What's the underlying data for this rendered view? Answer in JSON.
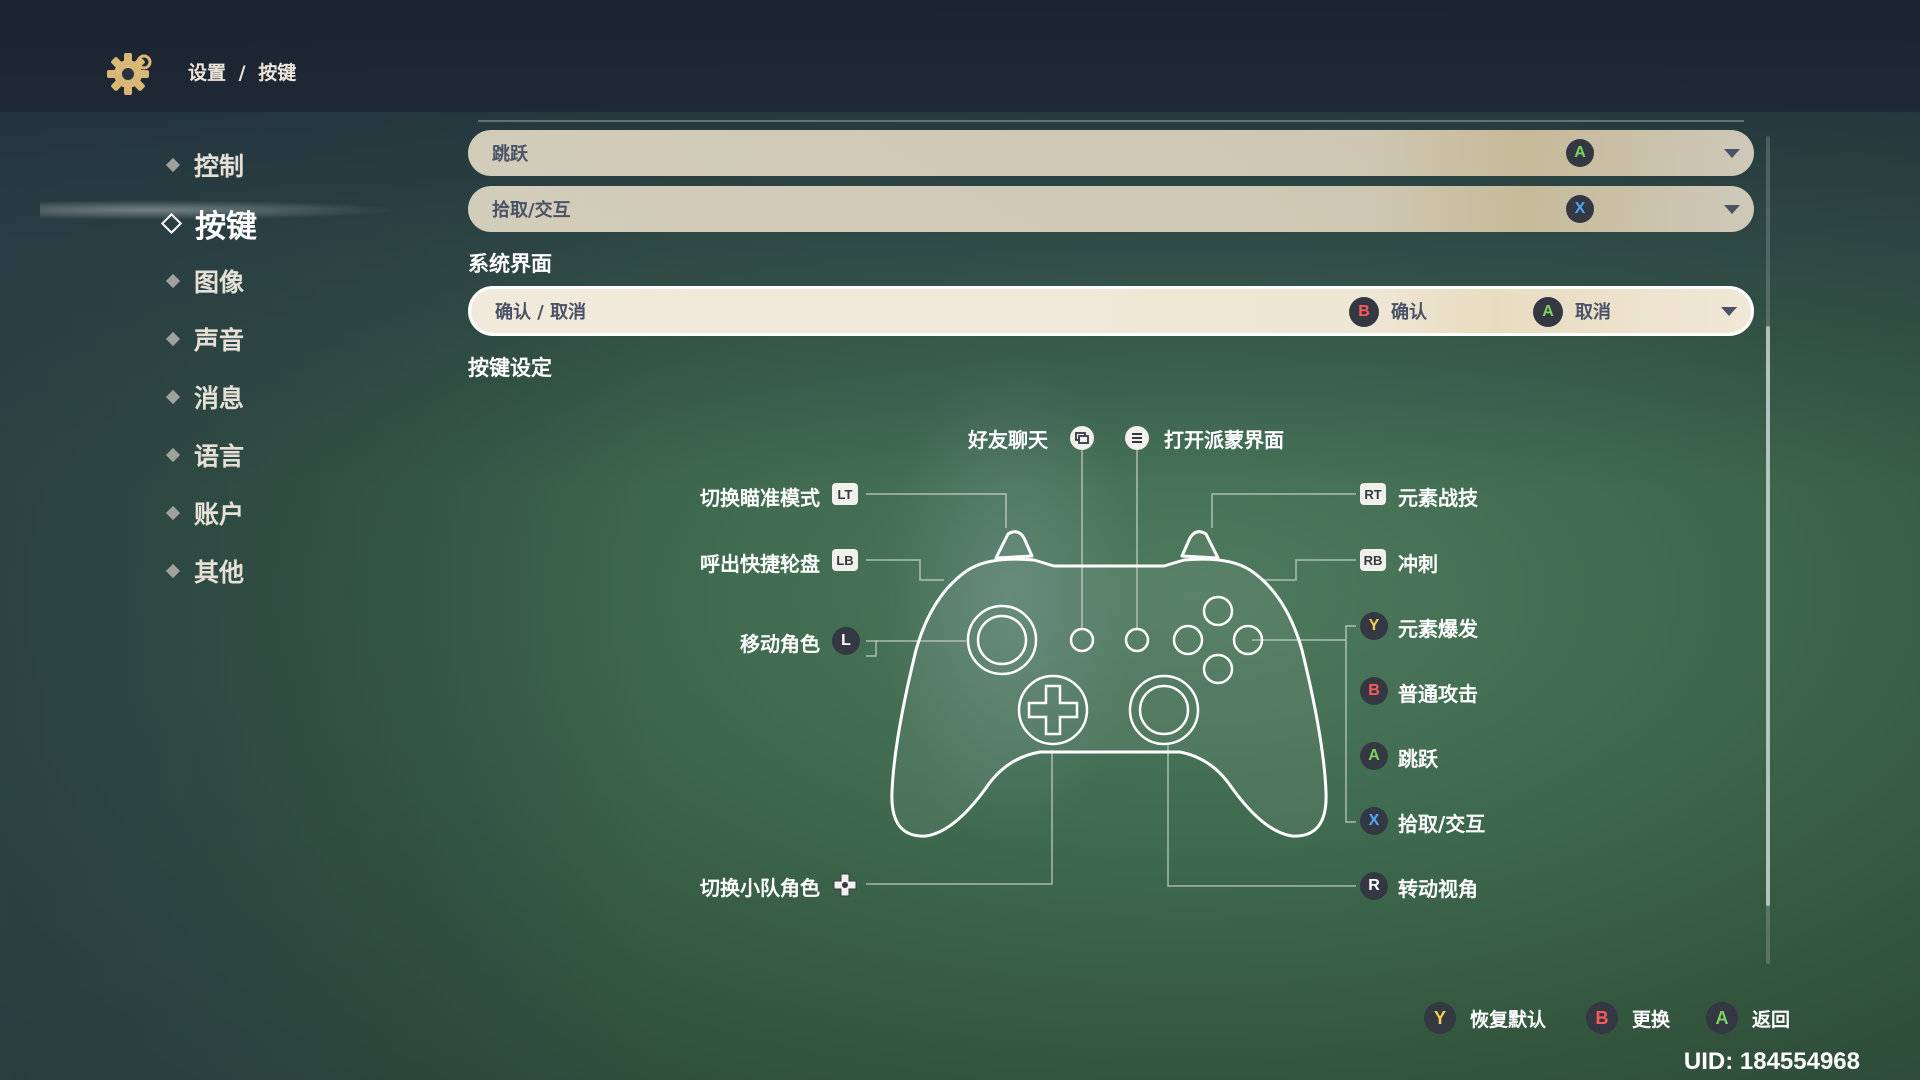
{
  "header": {
    "breadcrumb": [
      "设置",
      "/",
      "按键"
    ],
    "icon": "gear-icon"
  },
  "sidebar": {
    "items": [
      {
        "label": "控制",
        "active": false
      },
      {
        "label": "按键",
        "active": true
      },
      {
        "label": "图像",
        "active": false
      },
      {
        "label": "声音",
        "active": false
      },
      {
        "label": "消息",
        "active": false
      },
      {
        "label": "语言",
        "active": false
      },
      {
        "label": "账户",
        "active": false
      },
      {
        "label": "其他",
        "active": false
      }
    ]
  },
  "bindings": {
    "rows_top": [
      {
        "label": "跳跃",
        "button": "A",
        "button_color": "#7dd35d"
      },
      {
        "label": "拾取/交互",
        "button": "X",
        "button_color": "#52a8ff"
      }
    ],
    "system_section_title": "系统界面",
    "confirm_row": {
      "label": "确认 / 取消",
      "confirm_button": "B",
      "confirm_text": "确认",
      "cancel_button": "A",
      "cancel_text": "取消"
    },
    "keymap_section_title": "按键设定"
  },
  "controller_map": {
    "top": {
      "friend_chat": {
        "text": "好友聊天",
        "icon": "view-button-icon"
      },
      "paimon_menu": {
        "text": "打开派蒙界面",
        "icon": "menu-button-icon"
      }
    },
    "left": {
      "aim_mode": {
        "text": "切换瞄准模式",
        "key": "LT"
      },
      "quick_wheel": {
        "text": "呼出快捷轮盘",
        "key": "LB"
      },
      "move": {
        "text": "移动角色",
        "key": "L"
      },
      "switch_party": {
        "text": "切换小队角色",
        "icon": "dpad-icon"
      }
    },
    "right": {
      "elemental_skill": {
        "text": "元素战技",
        "key": "RT"
      },
      "sprint": {
        "text": "冲刺",
        "key": "RB"
      },
      "elemental_burst": {
        "text": "元素爆发",
        "key": "Y"
      },
      "normal_attack": {
        "text": "普通攻击",
        "key": "B"
      },
      "jump": {
        "text": "跳跃",
        "key": "A"
      },
      "pickup": {
        "text": "拾取/交互",
        "key": "X"
      },
      "camera": {
        "text": "转动视角",
        "key": "R"
      }
    }
  },
  "footer": {
    "hints": [
      {
        "key": "Y",
        "text": "恢复默认"
      },
      {
        "key": "B",
        "text": "更换"
      },
      {
        "key": "A",
        "text": "返回"
      }
    ],
    "uid": "UID: 184554968"
  },
  "colors": {
    "a": "#7dd35d",
    "b": "#ff5b5b",
    "x": "#52a8ff",
    "y": "#f2d04a",
    "row_text": "#4a5266"
  }
}
